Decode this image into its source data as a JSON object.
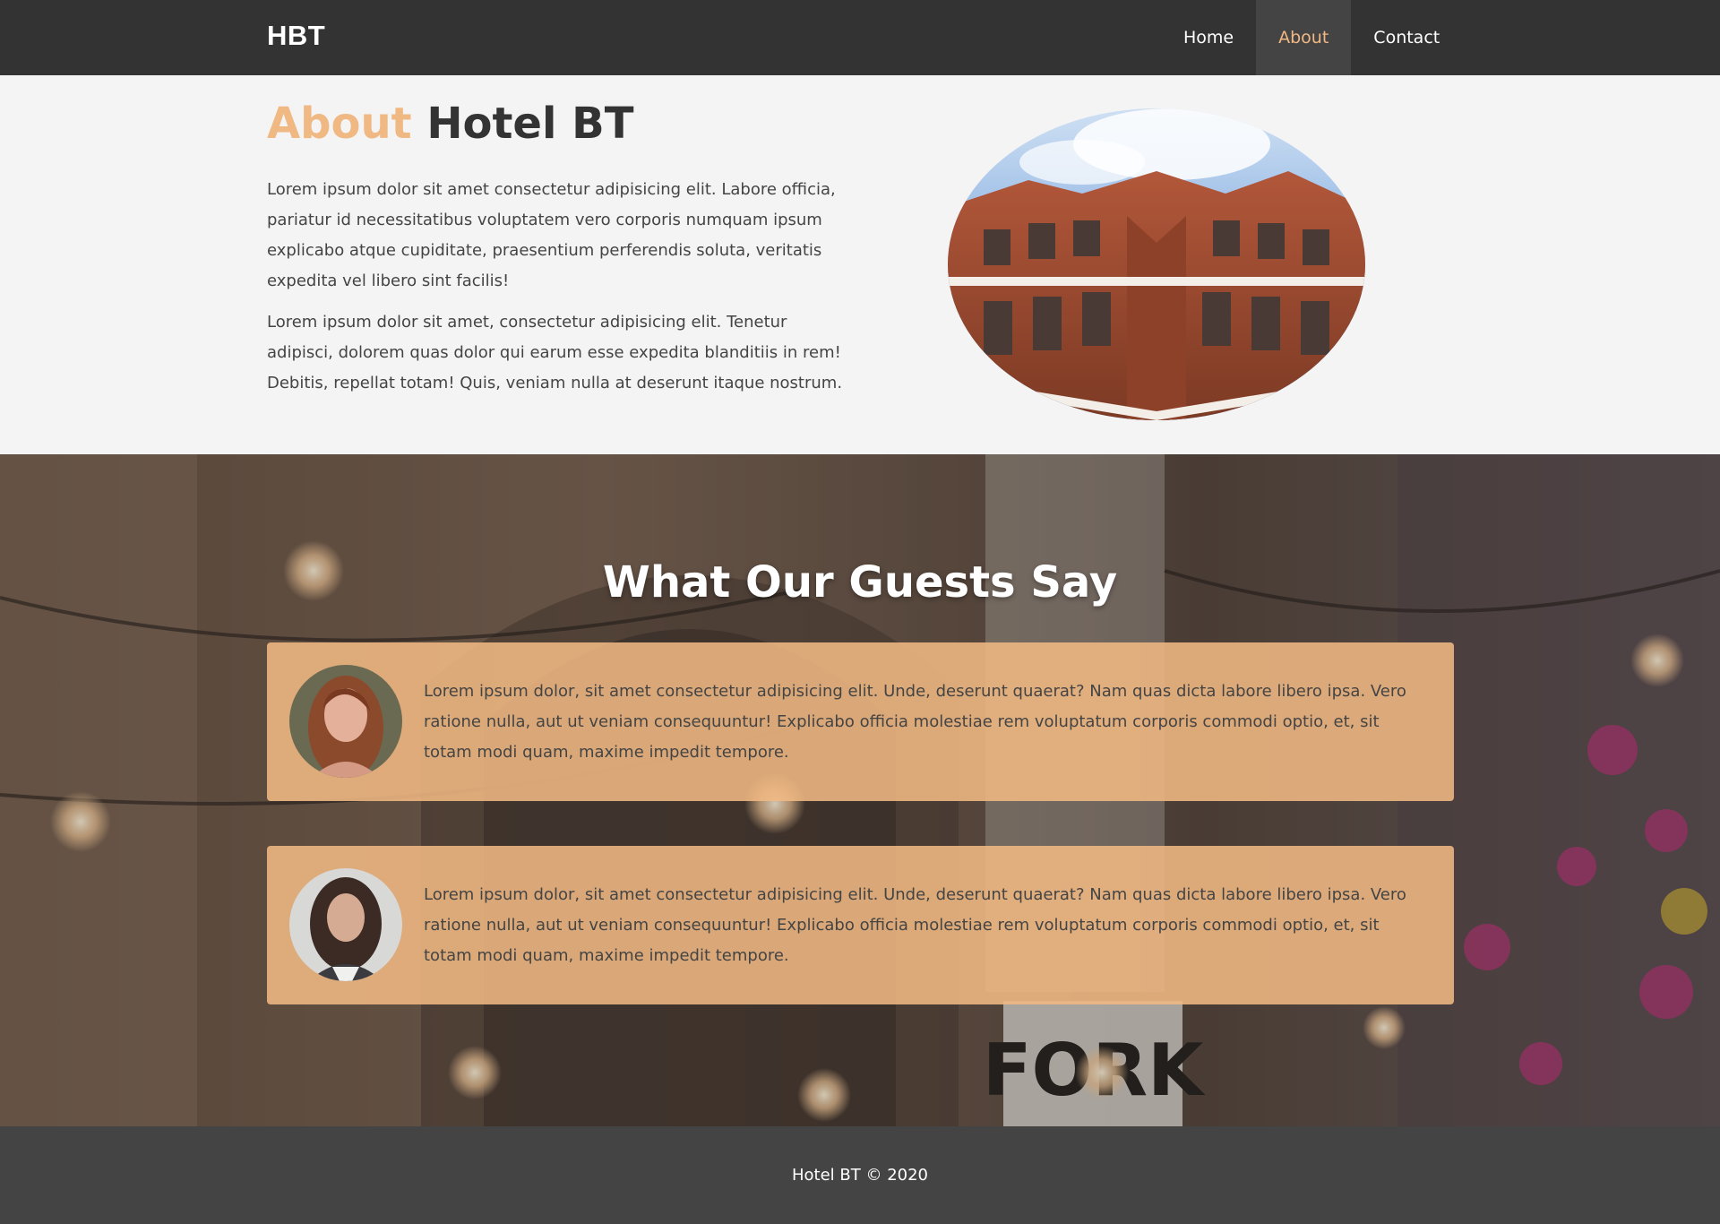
{
  "navbar": {
    "brand": "HBT",
    "items": [
      {
        "label": "Home",
        "active": false
      },
      {
        "label": "About",
        "active": true
      },
      {
        "label": "Contact",
        "active": false
      }
    ]
  },
  "about": {
    "title_accent": "About",
    "title_rest": "Hotel BT",
    "paragraphs": [
      "Lorem ipsum dolor sit amet consectetur adipisicing elit. Labore officia, pariatur id necessitatibus voluptatem vero corporis numquam ipsum explicabo atque cupiditate, praesentium perferendis soluta, veritatis expedita vel libero sint facilis!",
      "Lorem ipsum dolor sit amet, consectetur adipisicing elit. Tenetur adipisci, dolorem quas dolor qui earum esse expedita blanditiis in rem! Debitis, repellat totam! Quis, veniam nulla at deserunt itaque nostrum."
    ]
  },
  "testimonials": {
    "title": "What Our Guests Say",
    "items": [
      {
        "text": "Lorem ipsum dolor, sit amet consectetur adipisicing elit. Unde, deserunt quaerat? Nam quas dicta labore libero ipsa. Vero ratione nulla, aut ut veniam consequuntur! Explicabo officia molestiae rem voluptatum corporis commodi optio, et, sit totam modi quam, maxime impedit tempore."
      },
      {
        "text": "Lorem ipsum dolor, sit amet consectetur adipisicing elit. Unde, deserunt quaerat? Nam quas dicta labore libero ipsa. Vero ratione nulla, aut ut veniam consequuntur! Explicabo officia molestiae rem voluptatum corporis commodi optio, et, sit totam modi quam, maxime impedit tempore."
      }
    ]
  },
  "footer": {
    "text": "Hotel BT © 2020"
  },
  "colors": {
    "navbar_bg": "#333333",
    "accent": "#f0b883",
    "card_bg": "#f0b883",
    "footer_bg": "#444444",
    "page_bg": "#f4f4f4"
  }
}
